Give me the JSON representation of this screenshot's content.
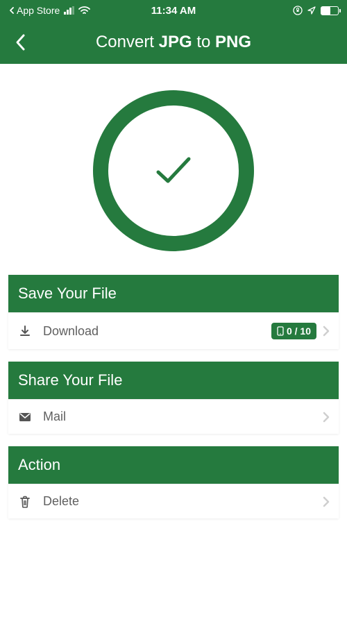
{
  "statusbar": {
    "appName": "App Store",
    "time": "11:34 AM"
  },
  "header": {
    "title_prefix": "Convert ",
    "title_from": "JPG",
    "title_mid": " to ",
    "title_to": "PNG"
  },
  "sections": {
    "save": {
      "header": "Save Your File",
      "download_label": "Download",
      "badge_text": "0 / 10"
    },
    "share": {
      "header": "Share Your File",
      "mail_label": "Mail"
    },
    "action": {
      "header": "Action",
      "delete_label": "Delete"
    }
  }
}
